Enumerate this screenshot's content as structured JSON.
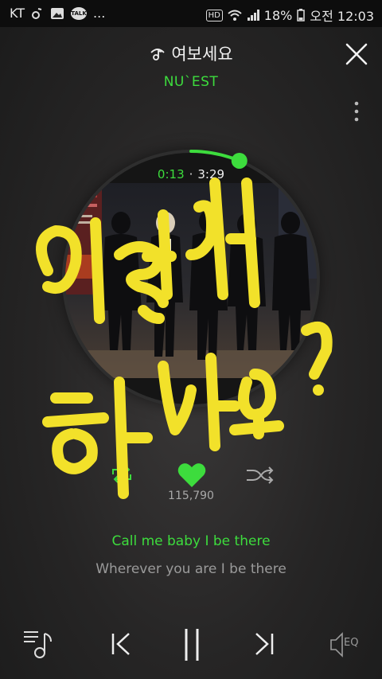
{
  "status_bar": {
    "carrier": "KT",
    "hd_label": "HD",
    "talk_label": "TALK",
    "more": "...",
    "battery": "18%",
    "time": "오전 12:03"
  },
  "player": {
    "song_title": "여보세요",
    "artist": "NU`EST",
    "time_current": "0:13",
    "time_separator": "·",
    "time_total": "3:29",
    "like_count": "115,790",
    "progress": 0.062,
    "liked": true
  },
  "lyrics": {
    "current": "Call me baby I be there",
    "next": "Wherever you are I be there"
  },
  "controls": {
    "eq_label": "EQ"
  },
  "colors": {
    "accent": "#3ddc3d",
    "scribble": "#f2e12a",
    "background": "#262525"
  },
  "icons": [
    "note-icon",
    "close-icon",
    "more-vertical-icon",
    "repeat-icon",
    "heart-icon",
    "shuffle-icon",
    "playlist-icon",
    "previous-icon",
    "pause-icon",
    "next-icon",
    "equalizer-icon"
  ]
}
